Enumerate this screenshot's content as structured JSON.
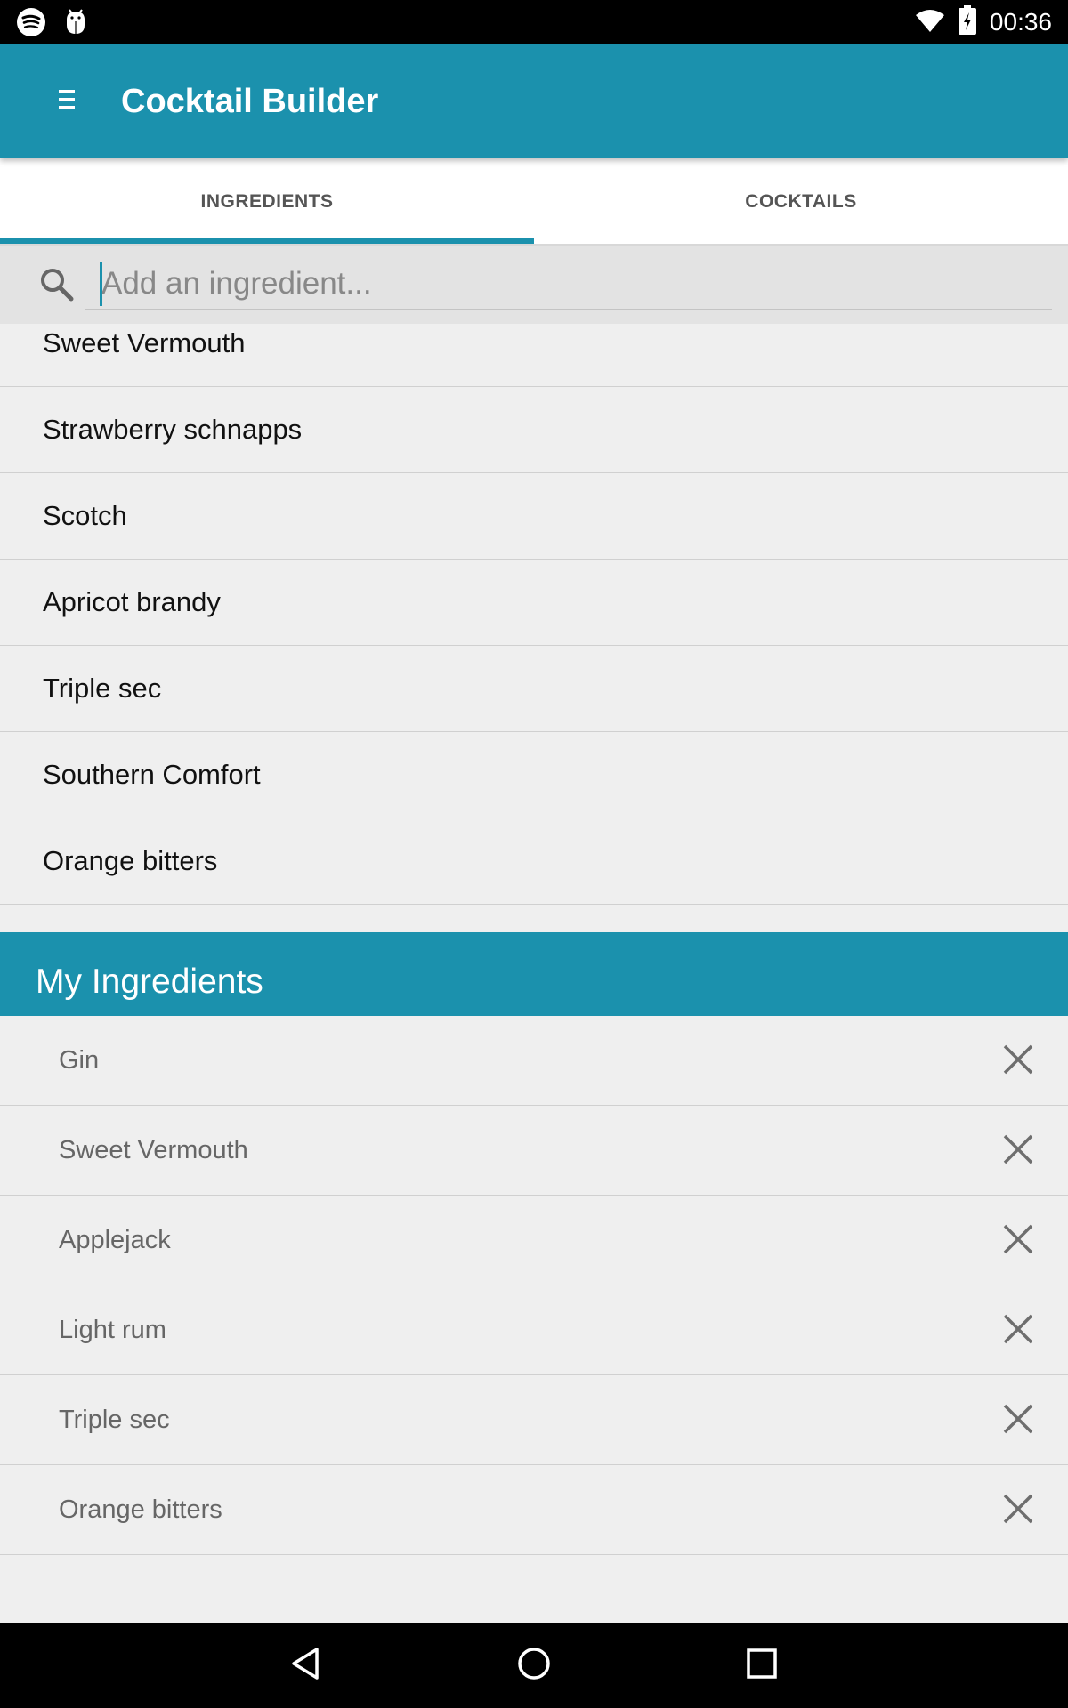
{
  "status_bar": {
    "time": "00:36",
    "left_icons": [
      "spotify-icon",
      "android-debug-icon"
    ],
    "right_icons": [
      "wifi-icon",
      "battery-charging-icon"
    ]
  },
  "app_bar": {
    "title": "Cocktail Builder",
    "menu_icon": "hamburger-menu-icon"
  },
  "tabs": [
    {
      "label": "INGREDIENTS",
      "active": true
    },
    {
      "label": "COCKTAILS",
      "active": false
    }
  ],
  "search": {
    "placeholder": "Add an ingredient...",
    "value": ""
  },
  "results": [
    {
      "label": "Sweet Vermouth"
    },
    {
      "label": "Strawberry schnapps"
    },
    {
      "label": "Scotch"
    },
    {
      "label": "Apricot brandy"
    },
    {
      "label": "Triple sec"
    },
    {
      "label": "Southern Comfort"
    },
    {
      "label": "Orange bitters"
    }
  ],
  "my_ingredients": {
    "header": "My Ingredients",
    "items": [
      {
        "label": "Gin"
      },
      {
        "label": "Sweet Vermouth"
      },
      {
        "label": "Applejack"
      },
      {
        "label": "Light rum"
      },
      {
        "label": "Triple sec"
      },
      {
        "label": "Orange bitters"
      }
    ]
  },
  "colors": {
    "accent": "#1b91ad",
    "background": "#efefef"
  }
}
